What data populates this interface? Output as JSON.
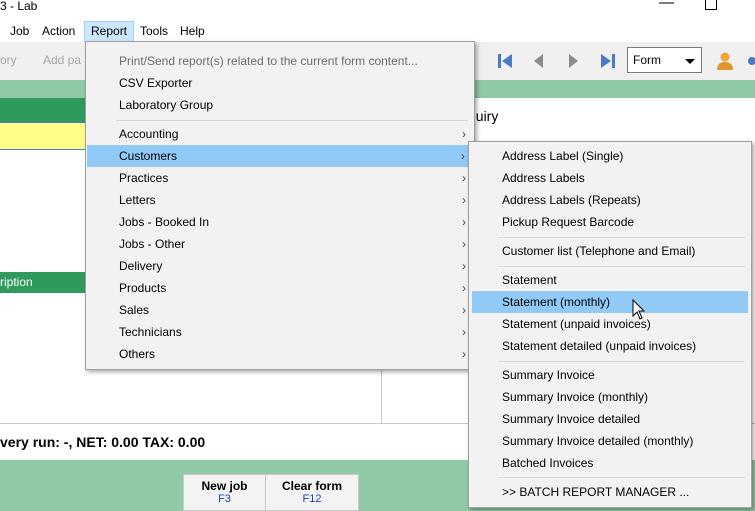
{
  "window": {
    "title": "3 - Lab"
  },
  "menubar": {
    "items": [
      "Job",
      "Action",
      "Report",
      "Tools",
      "Help"
    ]
  },
  "toolbar": {
    "left_items": [
      "ory",
      "Add pa"
    ],
    "view_select": "Form"
  },
  "content": {
    "inquiry_label": "quiry",
    "column_header": "ription",
    "status_line": "very run: -,   NET: 0.00   TAX: 0.00"
  },
  "function_buttons": [
    {
      "label": "New job",
      "key": "F3"
    },
    {
      "label": "Clear form",
      "key": "F12"
    }
  ],
  "report_menu": {
    "items": [
      {
        "label": "Print/Send report(s) related to the current form content...",
        "disabled": true
      },
      {
        "label": "CSV Exporter"
      },
      {
        "label": "Laboratory Group"
      },
      {
        "label": "Accounting",
        "submenu": true
      },
      {
        "label": "Customers",
        "submenu": true,
        "highlighted": true
      },
      {
        "label": "Practices",
        "submenu": true
      },
      {
        "label": "Letters",
        "submenu": true
      },
      {
        "label": "Jobs - Booked In",
        "submenu": true
      },
      {
        "label": "Jobs - Other",
        "submenu": true
      },
      {
        "label": "Delivery",
        "submenu": true
      },
      {
        "label": "Products",
        "submenu": true
      },
      {
        "label": "Sales",
        "submenu": true
      },
      {
        "label": "Technicians",
        "submenu": true
      },
      {
        "label": "Others",
        "submenu": true
      }
    ]
  },
  "customers_submenu": {
    "items": [
      {
        "label": "Address Label (Single)"
      },
      {
        "label": "Address Labels"
      },
      {
        "label": "Address Labels (Repeats)"
      },
      {
        "label": "Pickup Request Barcode"
      },
      {
        "label": "Customer list (Telephone and Email)"
      },
      {
        "label": "Statement"
      },
      {
        "label": "Statement (monthly)",
        "highlighted": true
      },
      {
        "label": "Statement (unpaid invoices)"
      },
      {
        "label": "Statement detailed (unpaid invoices)"
      },
      {
        "label": "Summary Invoice"
      },
      {
        "label": "Summary Invoice (monthly)"
      },
      {
        "label": "Summary Invoice detailed"
      },
      {
        "label": "Summary Invoice detailed (monthly)"
      },
      {
        "label": "Batched Invoices"
      },
      {
        "label": ">> BATCH REPORT MANAGER ..."
      }
    ]
  },
  "colors": {
    "accent_green": "#2e9a5b",
    "light_green": "#8fc9a5",
    "menu_highlight": "#91c9f7",
    "yellow_field": "#ffff88"
  }
}
